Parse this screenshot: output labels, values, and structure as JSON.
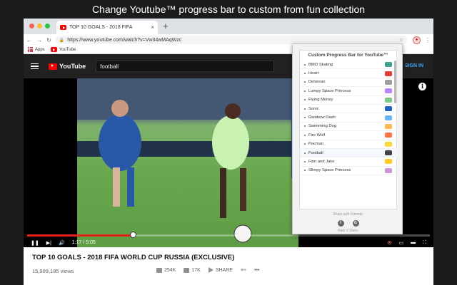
{
  "banner": "Change Youtube™ progress bar to custom from fun collection",
  "colors": {
    "window_dot_red": "#ff5f57",
    "window_dot_yellow": "#febc2e",
    "window_dot_green": "#28c840",
    "youtube_red": "#ff0000",
    "progress_red": "#e62117",
    "signin_blue": "#3ea6ff"
  },
  "tab": {
    "title": "TOP 10 GOALS - 2018 FIFA",
    "close": "×"
  },
  "newtab": "+",
  "toolbar": {
    "back": "←",
    "forward": "→",
    "reload": "↻",
    "url": "https://www.youtube.com/watch?v=Vw34wMAqWzc",
    "menu": "⋮"
  },
  "bookmarks": [
    {
      "label": "Apps",
      "icon": "apps-grid-icon"
    },
    {
      "label": "YouTube",
      "icon": "youtube-icon"
    }
  ],
  "youtube": {
    "logo_text": "YouTube",
    "search_value": "football",
    "signin": "SIGN IN"
  },
  "player": {
    "progress_fraction": 0.263,
    "time": "1:17 / 5:05"
  },
  "extension": {
    "title": "Custom Progress Bar for YouTube™",
    "items": [
      {
        "label": "BMO Skating",
        "color": "#3aa38c"
      },
      {
        "label": "Heart",
        "color": "#e53935"
      },
      {
        "label": "Delorean",
        "color": "#9e9e9e"
      },
      {
        "label": "Lumpy Space Princess",
        "color": "#b388ff"
      },
      {
        "label": "Flying Money",
        "color": "#81c784"
      },
      {
        "label": "Sonic",
        "color": "#1e63c6"
      },
      {
        "label": "Rainbow Dash",
        "color": "#64b5f6"
      },
      {
        "label": "Swimming Dog",
        "color": "#ffb74d"
      },
      {
        "label": "Fire Wolf",
        "color": "#ff7043"
      },
      {
        "label": "Pacman",
        "color": "#fdd835"
      },
      {
        "label": "Football",
        "color": "#424242"
      },
      {
        "label": "Finn and Jake",
        "color": "#ffca28"
      },
      {
        "label": "Slimpy Space Princess",
        "color": "#ce93d8"
      }
    ],
    "share_label": "Share with Friends:",
    "rate_label": "Rate 5 Stars:"
  },
  "video": {
    "title": "TOP 10 GOALS - 2018 FIFA WORLD CUP RUSSIA (EXCLUSIVE)",
    "views": "15,909,185 views",
    "likes": "254K",
    "dislikes": "17K",
    "share": "SHARE",
    "more": "•••"
  }
}
